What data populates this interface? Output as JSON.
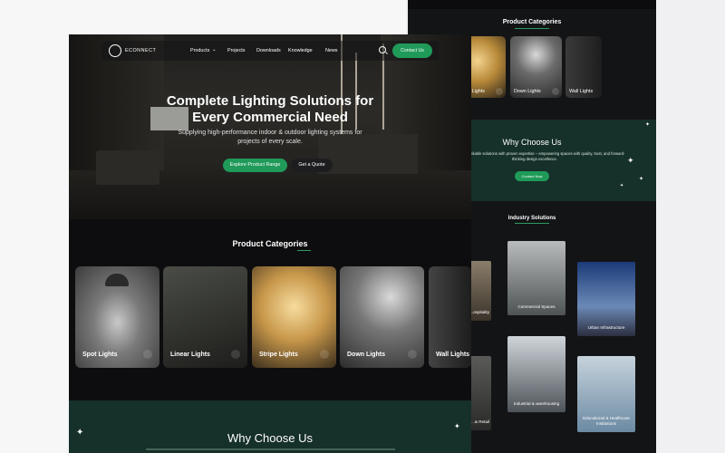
{
  "brand": {
    "name": "ECONNECT"
  },
  "nav": {
    "items": [
      "Products",
      "Projects",
      "Downloads",
      "Knowledge",
      "News"
    ],
    "contact_label": "Contact Us"
  },
  "hero": {
    "title_line1": "Complete Lighting Solutions for",
    "title_line2": "Every  Commercial Need",
    "subtitle": "Supplying high-performance indoor & outdoor lighting systems for projects of every scale.",
    "primary_button": "Explore Product Range",
    "secondary_button": "Get a Quote"
  },
  "product_categories": {
    "title": "Product Categories",
    "items": [
      "Spot Lights",
      "Linear Lights",
      "Stripe Lights",
      "Down Lights",
      "Wall Lights"
    ]
  },
  "why": {
    "title": "Why Choose Us",
    "text": "...r innovative, reliable solutions with proven expertise – empowering spaces with quality, trust, and forward-thinking design excellence.",
    "button": "Contact Now"
  },
  "industry": {
    "title": "Industry Solutions",
    "items": [
      "Commercial Spaces",
      "Urban Infrastructure",
      "Industrial & warehousing",
      "Educational & Healthcare Institutions",
      "...e & ...ospitality",
      "...& Retail"
    ]
  },
  "colors": {
    "accent": "#1f9a59",
    "dark_green": "#16302a",
    "background": "#0d0d0f"
  }
}
